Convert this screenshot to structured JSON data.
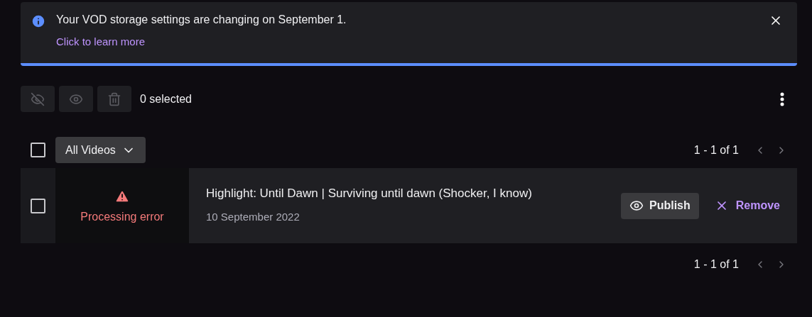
{
  "banner": {
    "message": "Your VOD storage settings are changing on September 1.",
    "link": "Click to learn more"
  },
  "toolbar": {
    "actions": [
      {
        "kind": "unpublish",
        "disabled": true
      },
      {
        "kind": "publish",
        "disabled": true
      },
      {
        "kind": "delete",
        "disabled": true
      }
    ],
    "selection_count": "0 selected"
  },
  "filter": {
    "select_all_checked": false,
    "dropdown": "All Videos"
  },
  "pagination_top": "1 - 1 of 1",
  "videos": [
    {
      "checked": false,
      "status": "Processing error",
      "title": "Highlight: Until Dawn | Surviving until dawn (Shocker, I know)",
      "date": "10 September 2022",
      "publish": "Publish",
      "remove": "Remove"
    }
  ],
  "pagination_bottom": "1 - 1 of 1"
}
